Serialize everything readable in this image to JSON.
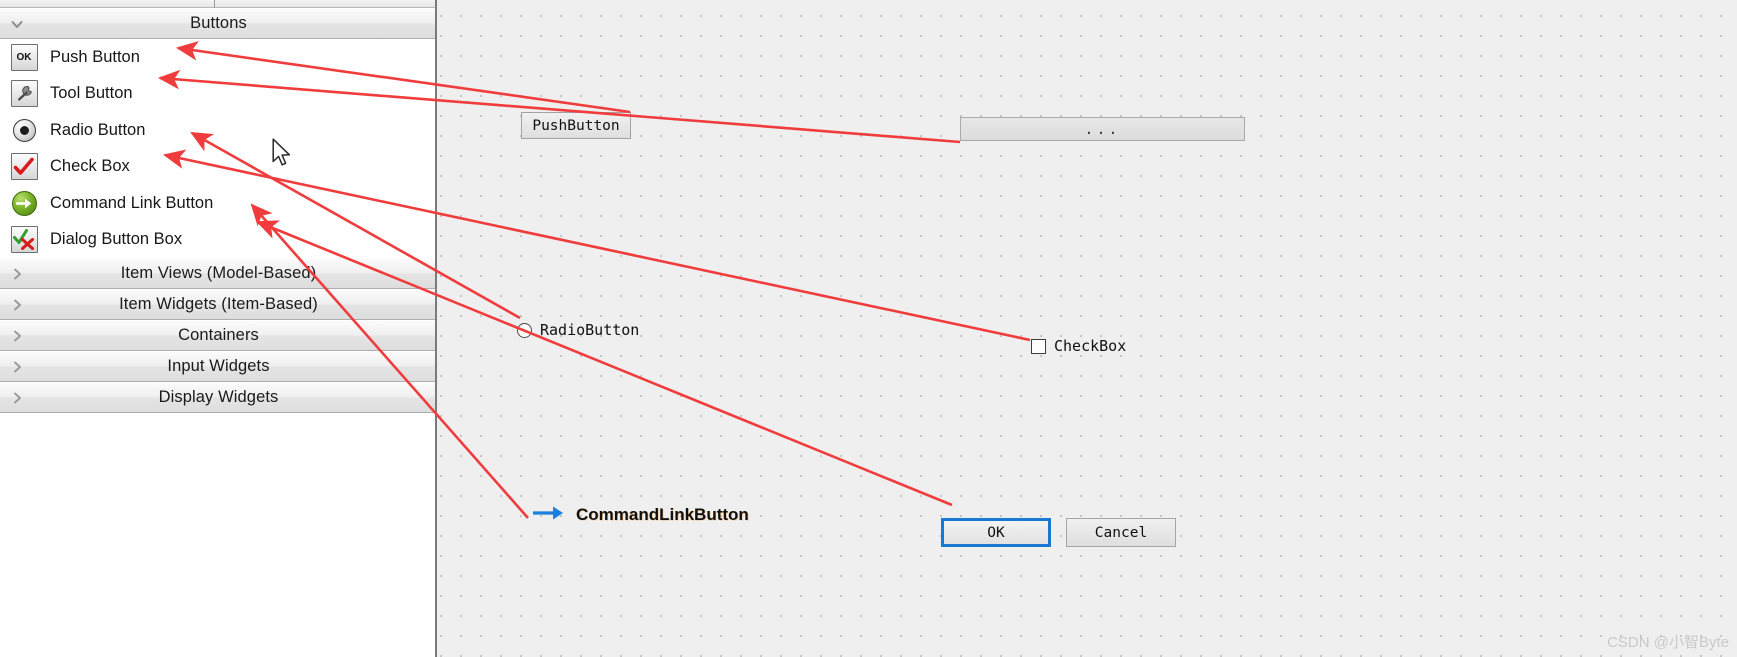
{
  "widget_box": {
    "active_category": {
      "label": "Buttons",
      "expanded": true,
      "chevron_icon": "chevron-down-icon"
    },
    "items": [
      {
        "label": "Push Button",
        "icon": "push-button-icon",
        "icon_text": "OK"
      },
      {
        "label": "Tool Button",
        "icon": "tool-button-icon",
        "icon_text": ""
      },
      {
        "label": "Radio Button",
        "icon": "radio-button-icon",
        "icon_text": ""
      },
      {
        "label": "Check Box",
        "icon": "check-box-icon",
        "icon_text": ""
      },
      {
        "label": "Command Link Button",
        "icon": "command-link-button-icon",
        "icon_text": ""
      },
      {
        "label": "Dialog Button Box",
        "icon": "dialog-button-box-icon",
        "icon_text": ""
      }
    ],
    "collapsed_categories": [
      {
        "label": "Item Views (Model-Based)",
        "chevron_icon": "chevron-right-icon"
      },
      {
        "label": "Item Widgets (Item-Based)",
        "chevron_icon": "chevron-right-icon"
      },
      {
        "label": "Containers",
        "chevron_icon": "chevron-right-icon"
      },
      {
        "label": "Input Widgets",
        "chevron_icon": "chevron-right-icon"
      },
      {
        "label": "Display Widgets",
        "chevron_icon": "chevron-right-icon"
      }
    ]
  },
  "form_canvas": {
    "push_button": {
      "text": "PushButton"
    },
    "tool_button": {
      "text": "..."
    },
    "radio_button": {
      "text": "RadioButton",
      "checked": false
    },
    "check_box": {
      "text": "CheckBox",
      "checked": false
    },
    "command_link_button": {
      "text": "CommandLinkButton",
      "arrow_icon": "arrow-right-icon"
    },
    "dialog_button_box": {
      "ok_label": "OK",
      "cancel_label": "Cancel"
    }
  },
  "annotations": {
    "arrow_color": "#f03c3c",
    "count": 6
  },
  "colors": {
    "canvas_background": "#efefef",
    "grid_dot": "#b7b7b7",
    "annotation_red": "#f03c3c",
    "ok_button_focus_border": "#1878d4",
    "command_link_arrow": "#1b7fe0",
    "watermark_text": "#c9c9c9"
  },
  "watermark": {
    "text": "CSDN @小智Byte"
  }
}
